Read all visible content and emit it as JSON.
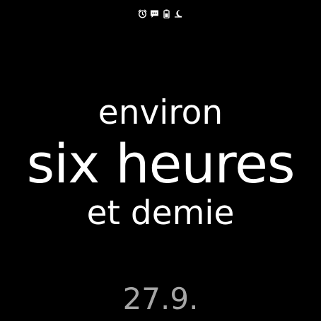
{
  "status_bar": {
    "icons": [
      "alarm-icon",
      "message-icon",
      "battery-icon",
      "sleep-icon"
    ]
  },
  "clock": {
    "line1": "environ",
    "line2": "six heures",
    "line3": "et demie"
  },
  "date": "27.9.",
  "colors": {
    "background": "#000000",
    "primary_text": "#ffffff",
    "date_text": "#a6a6a6"
  }
}
